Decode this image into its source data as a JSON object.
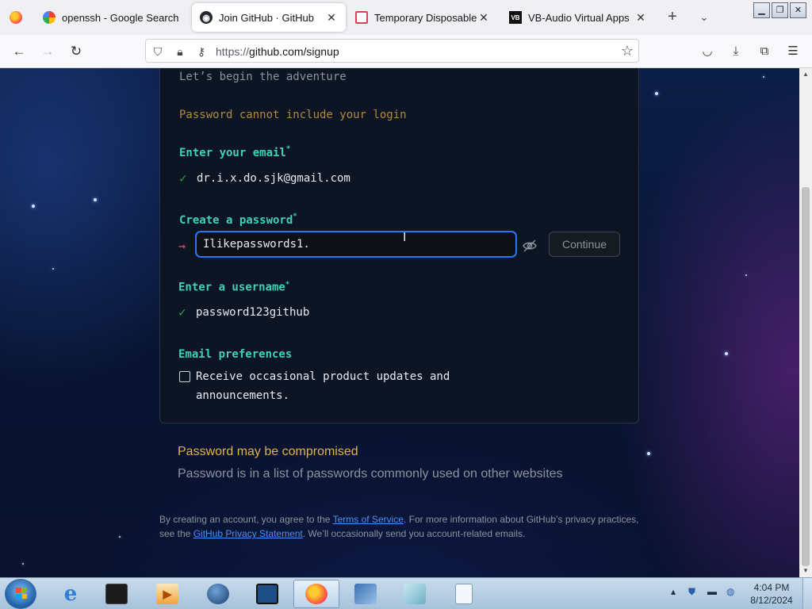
{
  "browser": {
    "tabs": [
      {
        "title": "openssh - Google Search",
        "favicon": "google-icon",
        "active": false
      },
      {
        "title": "Join GitHub · GitHub",
        "favicon": "github-icon",
        "active": true
      },
      {
        "title": "Temporary Disposable Gm",
        "favicon": "mail-icon",
        "active": false
      },
      {
        "title": "VB-Audio Virtual Apps",
        "favicon": "vb-audio-icon",
        "active": false
      }
    ],
    "url_scheme": "https://",
    "url_host_path": "github.com/signup",
    "new_tab_glyph": "+",
    "list_tabs_glyph": "⌄"
  },
  "signup": {
    "lead": "Let’s begin the adventure",
    "password_warning": "Password cannot include your login",
    "email": {
      "label": "Enter your email",
      "value": "dr.i.x.do.sjk@gmail.com"
    },
    "password": {
      "label": "Create a password",
      "value": "Ilikepasswords1."
    },
    "continue_label": "Continue",
    "username": {
      "label": "Enter a username",
      "value": "password123github"
    },
    "prefs": {
      "label": "Email preferences",
      "checkbox_text": "Receive occasional product updates and announcements.",
      "checked": false
    },
    "required_mark": "*",
    "check_glyph": "✓",
    "arrow_glyph": "→"
  },
  "compromised": {
    "title": "Password may be compromised",
    "description": "Password is in a list of passwords commonly used on other websites"
  },
  "legal": {
    "part1": "By creating an account, you agree to the ",
    "terms_link": "Terms of Service",
    "part2": ". For more information about GitHub’s privacy practices, see the ",
    "privacy_link": "GitHub Privacy Statement",
    "part3": ". We’ll occasionally send you account-related emails."
  },
  "taskbar": {
    "apps": [
      "windows-explorer-icon",
      "internet-explorer-icon",
      "terminal-icon",
      "media-player-icon",
      "globe-icon",
      "monitor-icon",
      "firefox-icon",
      "network-icon",
      "book-icon",
      "notepad-icon"
    ],
    "time": "4:04 PM",
    "date": "8/12/2024"
  },
  "colors": {
    "accent_label": "#3fd1b8",
    "warning": "#e3b341",
    "focus_border": "#2f81f7",
    "check": "#2ea043",
    "arrow": "#f0506e"
  }
}
